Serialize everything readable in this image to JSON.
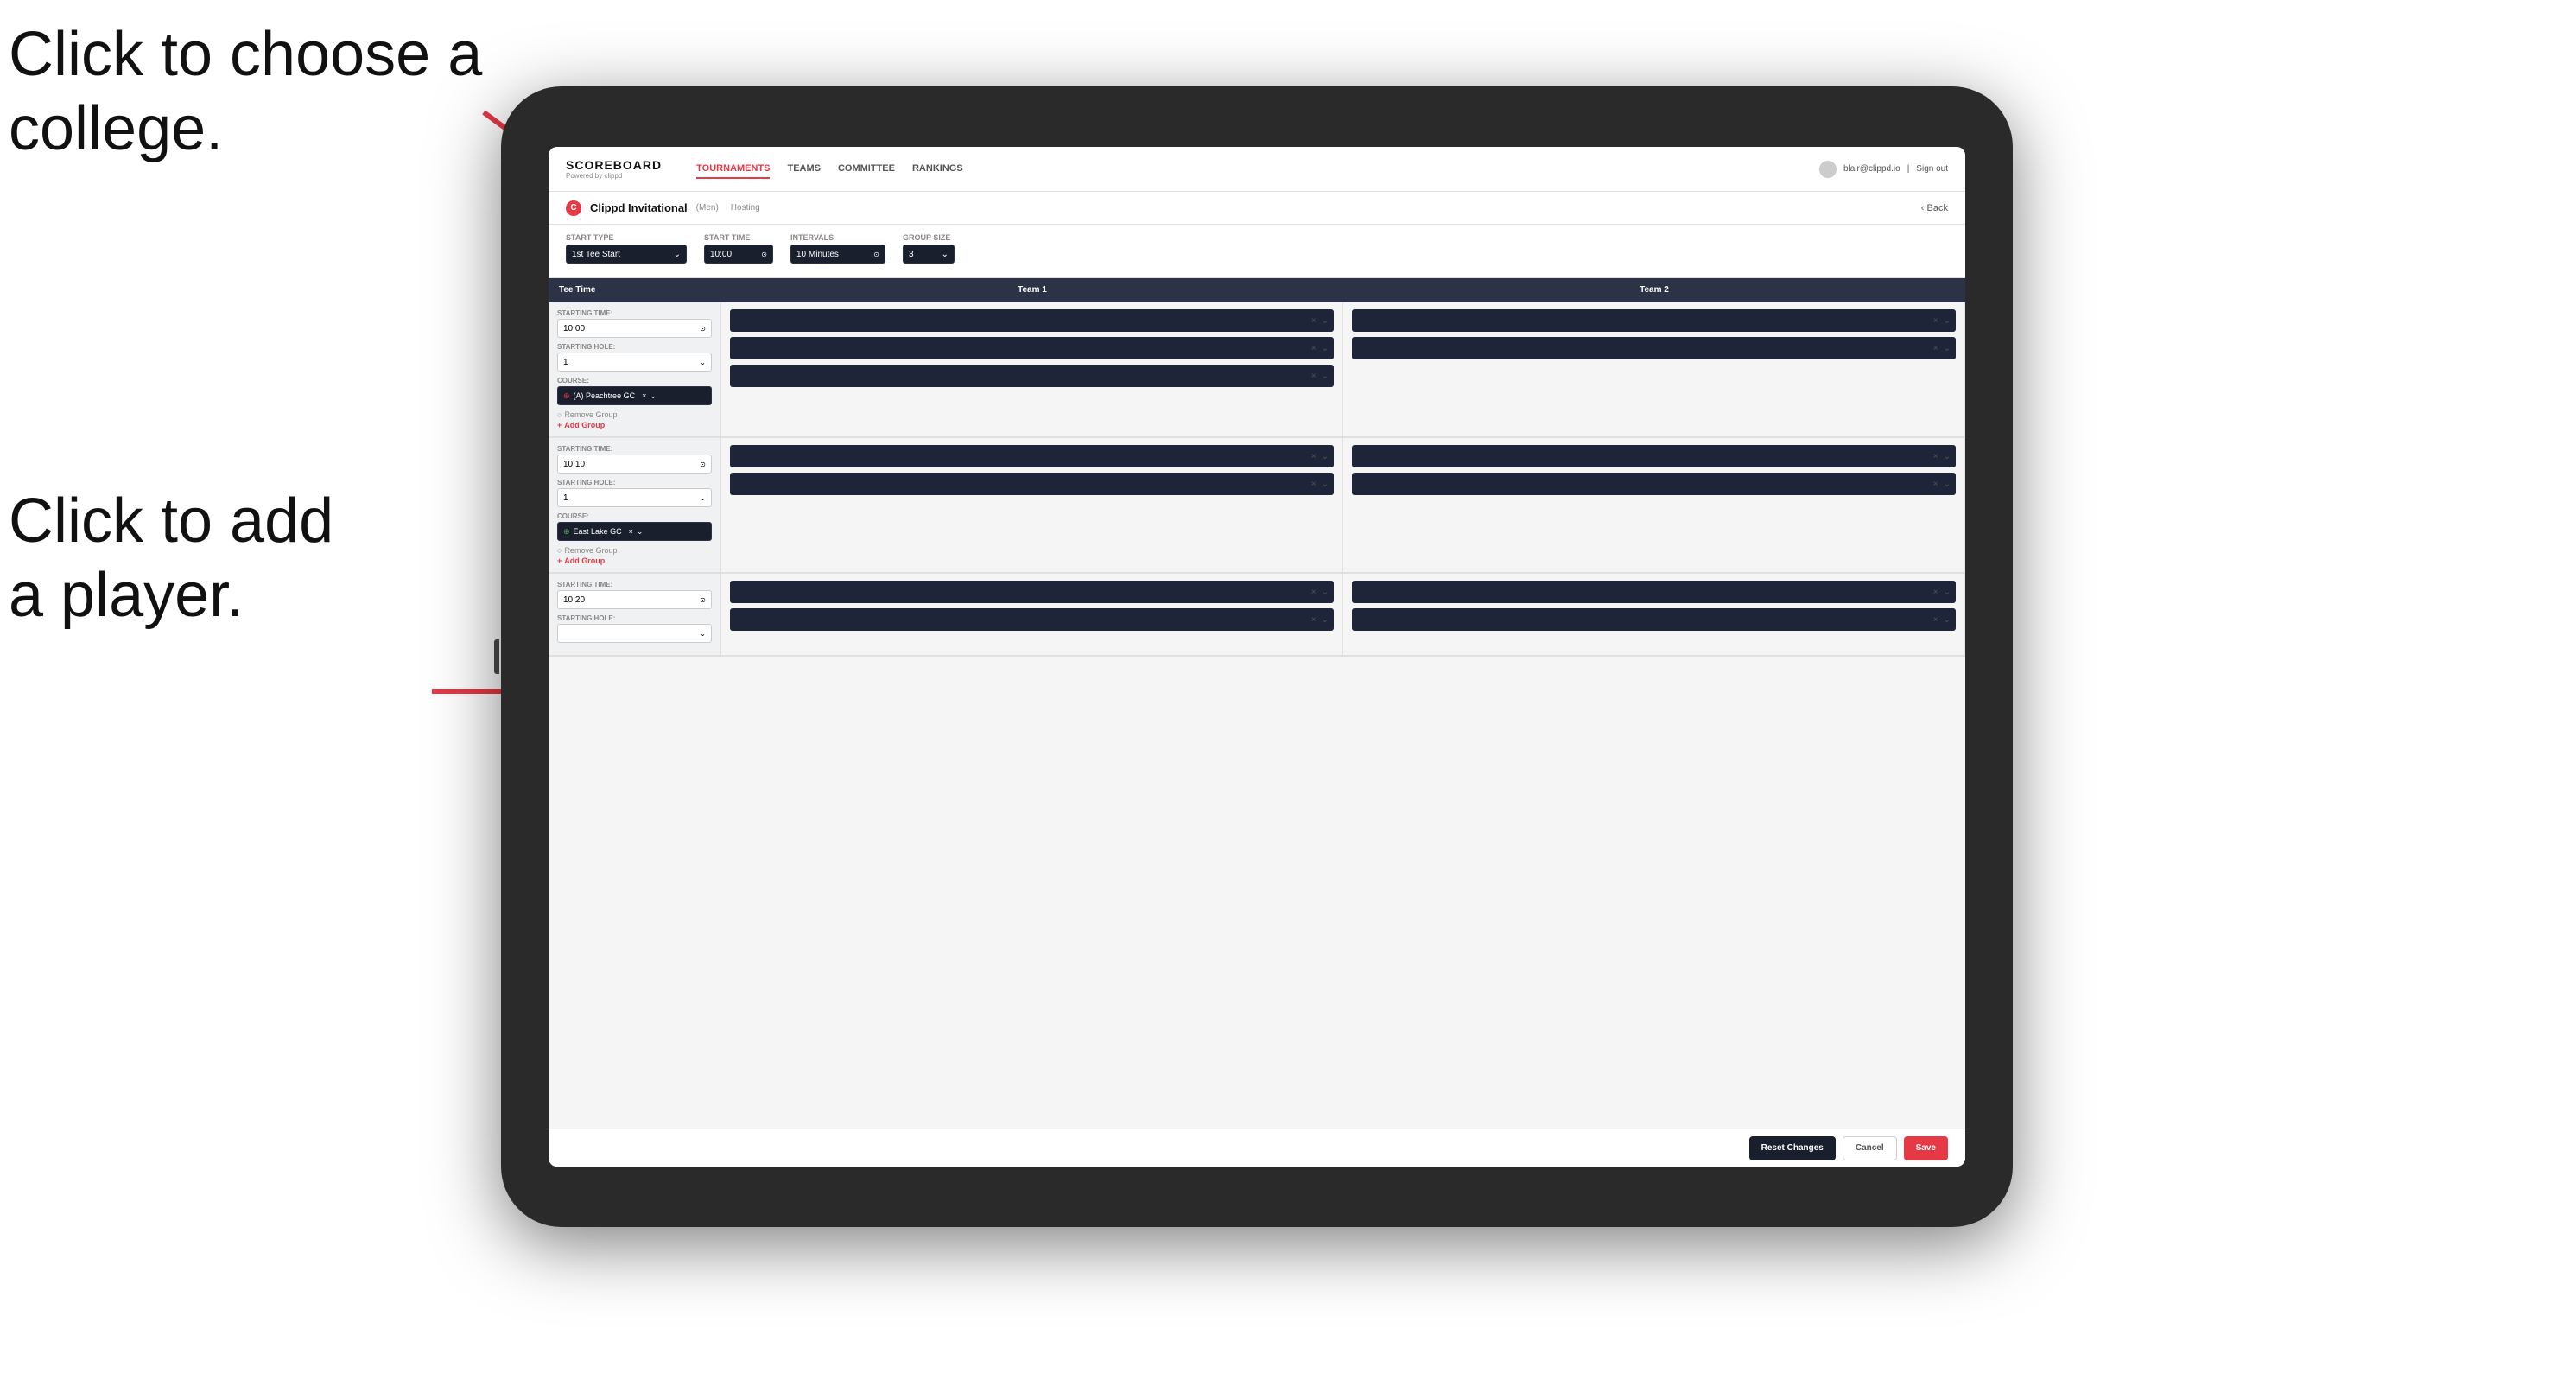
{
  "annotations": {
    "top": "Click to choose a\ncollege.",
    "bottom": "Click to add\na player."
  },
  "nav": {
    "brand": "SCOREBOARD",
    "brand_sub": "Powered by clippd",
    "links": [
      "TOURNAMENTS",
      "TEAMS",
      "COMMITTEE",
      "RANKINGS"
    ],
    "active_link": "TOURNAMENTS",
    "user_email": "blair@clippd.io",
    "sign_out": "Sign out"
  },
  "sub_header": {
    "title": "Clippd Invitational",
    "badge": "(Men)",
    "tag": "Hosting",
    "back": "Back"
  },
  "controls": {
    "start_type_label": "Start Type",
    "start_type_value": "1st Tee Start",
    "start_time_label": "Start Time",
    "start_time_value": "10:00",
    "intervals_label": "Intervals",
    "intervals_value": "10 Minutes",
    "group_size_label": "Group Size",
    "group_size_value": "3"
  },
  "table": {
    "col_tee_time": "Tee Time",
    "col_team1": "Team 1",
    "col_team2": "Team 2"
  },
  "groups": [
    {
      "starting_time": "10:00",
      "starting_hole": "1",
      "course": "(A) Peachtree GC",
      "team1_players": 3,
      "team2_players": 2,
      "has_remove": true,
      "has_add": true,
      "add_label": "Add Group",
      "remove_label": "Remove Group"
    },
    {
      "starting_time": "10:10",
      "starting_hole": "1",
      "course": "East Lake GC",
      "team1_players": 2,
      "team2_players": 2,
      "has_remove": true,
      "has_add": true,
      "add_label": "Add Group",
      "remove_label": "Remove Group"
    },
    {
      "starting_time": "10:20",
      "starting_hole": "",
      "course": "",
      "team1_players": 2,
      "team2_players": 2,
      "has_remove": false,
      "has_add": false,
      "add_label": "",
      "remove_label": ""
    }
  ],
  "bottom_bar": {
    "reset_label": "Reset Changes",
    "cancel_label": "Cancel",
    "save_label": "Save"
  }
}
